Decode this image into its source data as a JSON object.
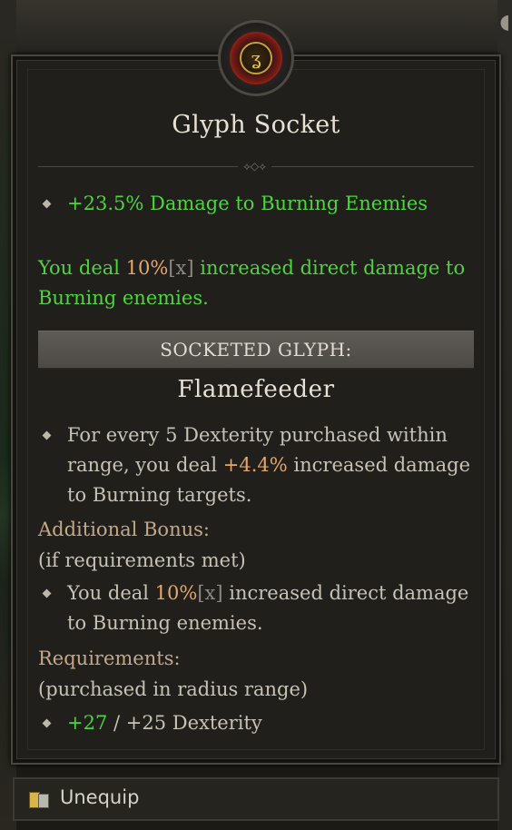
{
  "tooltip": {
    "title": "Glyph Socket",
    "medallion_icon": "glyph-rune-icon",
    "affix": {
      "text": "+23.5% Damage to Burning Enemies"
    },
    "socket_bonus": {
      "part1": "You deal ",
      "value": "10%",
      "bracket": "[x]",
      "part2": " increased direct damage to",
      "line2": "Burning enemies."
    },
    "socketed_label": "SOCKETED GLYPH:",
    "glyph_name": "Flamefeeder",
    "glyph_effect": {
      "line1": "For every 5 Dexterity purchased within",
      "line2_a": "range, you deal ",
      "line2_value": "+4.4%",
      "line2_b": " increased damage",
      "line3": "to Burning targets."
    },
    "additional_bonus": {
      "heading": "Additional Bonus:",
      "note": "(if requirements met)",
      "part1": "You deal ",
      "value": "10%",
      "bracket": "[x]",
      "part2": " increased direct damage",
      "line2": "to Burning enemies."
    },
    "requirements": {
      "heading": "Requirements:",
      "note": "(purchased in radius range)",
      "current": "+27",
      "separator": " / ",
      "required": "+25 Dexterity"
    }
  },
  "footer": {
    "unequip_label": "Unequip",
    "unequip_icon": "keybind-icon"
  },
  "colors": {
    "affix_green": "#4fd43f",
    "value_orange": "#e6a76a",
    "heading_tan": "#c5a987",
    "panel_bg": "#201f1c"
  }
}
